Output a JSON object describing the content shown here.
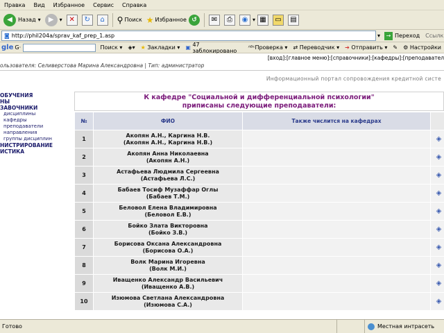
{
  "menu": [
    "Правка",
    "Вид",
    "Избранное",
    "Сервис",
    "Справка"
  ],
  "toolbar": {
    "back_label": "Назад",
    "search_label": "Поиск",
    "favorites_label": "Избранное"
  },
  "address": {
    "url": "http://phil204a/sprav_kaf_prep_1.asp",
    "go_label": "Переход",
    "trailing": "Ссылк"
  },
  "google_bar": {
    "logo": "gle",
    "search_label": "Поиск",
    "bookmarks_label": "Закладки",
    "blocked_label": "47 заблокировано",
    "check_label": "Проверка",
    "translate_label": "Переводчик",
    "send_label": "Отправить",
    "settings_label": "Настройки"
  },
  "page": {
    "nav_links": "[вход]:[главное меню]:[справочники]:[кафедры]:[преподавател",
    "user_line_prefix": "ользователя:",
    "user_name": "Селиверстова Марина Александровна",
    "user_type_label": "Тип:",
    "user_type": "администратор",
    "portal_title": "Информационный портал сопровождения кредитной систе"
  },
  "sidebar": {
    "items": [
      {
        "text": "ОБУЧЕНИЯ",
        "sub": false
      },
      {
        "text": "НЫ",
        "sub": false
      },
      {
        "text": "ЗАВОЧНИКИ",
        "sub": false
      },
      {
        "text": "дисциплины",
        "sub": true
      },
      {
        "text": "кафедры",
        "sub": true
      },
      {
        "text": "преподаватели",
        "sub": true
      },
      {
        "text": "направления",
        "sub": true
      },
      {
        "text": "группы дисциплин",
        "sub": true
      },
      {
        "text": "НИСТРИРОВАНИЕ",
        "sub": false
      },
      {
        "text": "ИСТИКА",
        "sub": false
      }
    ]
  },
  "table": {
    "caption_line1": "К кафедре \"Социальной и дифференциальной психологии\"",
    "caption_line2": "приписаны следующие преподаватели:",
    "headers": {
      "num": "№",
      "name": "ФИО",
      "other": "Также числится на кафедрах"
    },
    "rows": [
      {
        "num": "1",
        "line1": "Акопян А.Н., Каргина Н.В.",
        "line2": "(Акопян А.Н., Каргина Н.В.)",
        "other": ""
      },
      {
        "num": "2",
        "line1": "Акопян Анна Николаевна",
        "line2": "(Акопян А.Н.)",
        "other": ""
      },
      {
        "num": "3",
        "line1": "Астафьева Людмила Сергеевна",
        "line2": "(Астафьева Л.С.)",
        "other": ""
      },
      {
        "num": "4",
        "line1": "Бабаев Тосиф Музаффар Оглы",
        "line2": "(Бабаев Т.М.)",
        "other": ""
      },
      {
        "num": "5",
        "line1": "Беловол Елена Владимировна",
        "line2": "(Беловол Е.В.)",
        "other": ""
      },
      {
        "num": "6",
        "line1": "Бойко Злата Викторовна",
        "line2": "(Бойко З.В.)",
        "other": ""
      },
      {
        "num": "7",
        "line1": "Борисова Оксана Александровна",
        "line2": "(Борисова О.А.)",
        "other": ""
      },
      {
        "num": "8",
        "line1": "Волк Марина Игоревна",
        "line2": "(Волк М.И.)",
        "other": ""
      },
      {
        "num": "9",
        "line1": "Иващенко Александр Васильевич",
        "line2": "(Иващенко А.В.)",
        "other": ""
      },
      {
        "num": "10",
        "line1": "Изюмова Светлана Александровна",
        "line2": "(Изюмова С.А.)",
        "other": ""
      }
    ]
  },
  "status": {
    "ready": "Готово",
    "zone": "Местная интрасеть"
  }
}
